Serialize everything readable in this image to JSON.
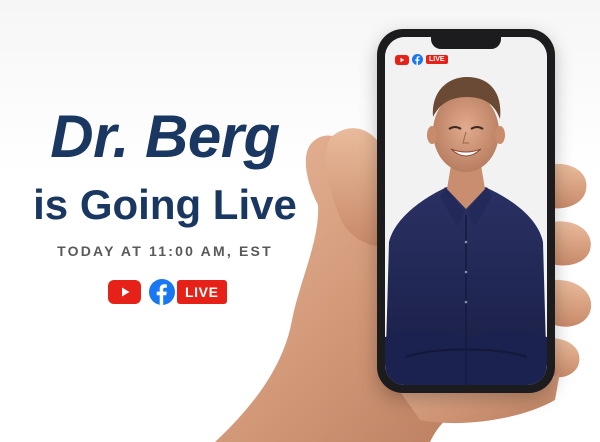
{
  "headline": {
    "name": "Dr. Berg",
    "tagline": "is Going Live",
    "schedule": "TODAY AT 11:00 AM, EST"
  },
  "badges": {
    "youtube_icon": "youtube-icon",
    "facebook_icon": "facebook-icon",
    "live_label": "LIVE"
  },
  "phone": {
    "screen_badges": {
      "youtube_icon": "youtube-icon",
      "facebook_icon": "facebook-icon",
      "live_label": "LIVE"
    }
  },
  "colors": {
    "headline": "#1a3761",
    "subline": "#595959",
    "youtube_red": "#e62117",
    "facebook_blue": "#1877f2",
    "shirt": "#1f2650"
  }
}
